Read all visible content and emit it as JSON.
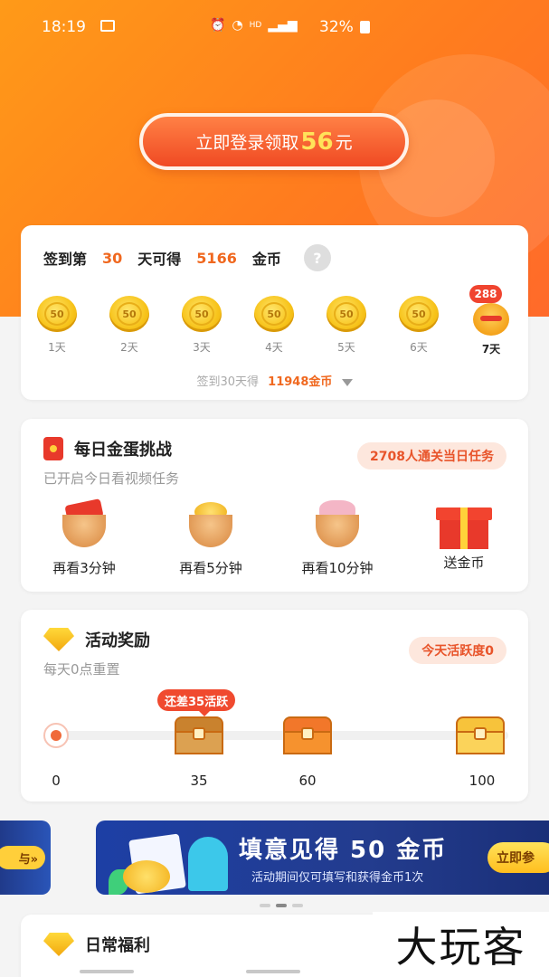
{
  "status": {
    "time": "18:19",
    "net": "HD",
    "battery": "32%"
  },
  "hero": {
    "login_prefix": "立即登录领取",
    "login_amount": "56",
    "login_suffix": "元"
  },
  "signin": {
    "p1": "签到第",
    "day": "30",
    "p2": "天可得",
    "coins": "5166",
    "p3": "金币",
    "help": "?",
    "days": [
      {
        "value": "50",
        "label": "1天"
      },
      {
        "value": "50",
        "label": "2天"
      },
      {
        "value": "50",
        "label": "3天"
      },
      {
        "value": "50",
        "label": "4天"
      },
      {
        "value": "50",
        "label": "5天"
      },
      {
        "value": "50",
        "label": "6天"
      },
      {
        "value": "288",
        "label": "7天"
      }
    ],
    "summary_prefix": "签到30天得",
    "summary_value": "11948金币"
  },
  "egg": {
    "title": "每日金蛋挑战",
    "subtitle": "已开启今日看视频任务",
    "pill": "2708人通关当日任务",
    "items": [
      "再看3分钟",
      "再看5分钟",
      "再看10分钟",
      "送金币"
    ]
  },
  "activity": {
    "title": "活动奖励",
    "subtitle": "每天0点重置",
    "pill": "今天活跃度0",
    "tag": "还差35活跃",
    "milestones": [
      "0",
      "35",
      "60",
      "100"
    ],
    "progress": 0
  },
  "banner": {
    "left_btn": "与»",
    "title": "填意见得 50 金币",
    "subtitle": "活动期间仅可填写和获得金币1次",
    "btn": "立即参"
  },
  "welfare": {
    "title": "日常福利"
  },
  "watermark": "大玩客",
  "colors": {
    "accent": "#f0681f",
    "hero": "#ff8a1e",
    "red": "#e8392b"
  }
}
